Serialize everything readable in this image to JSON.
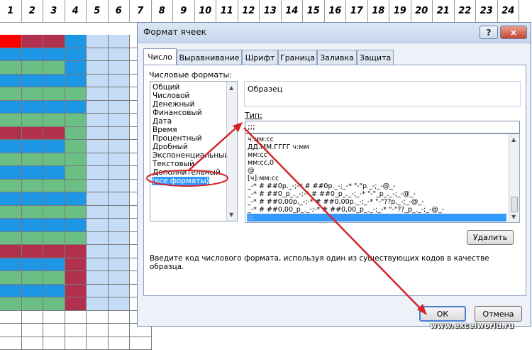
{
  "columns": [
    "1",
    "2",
    "3",
    "4",
    "5",
    "6",
    "7",
    "8",
    "9",
    "10",
    "11",
    "12",
    "13",
    "14",
    "15",
    "16",
    "17",
    "18",
    "19",
    "20",
    "21",
    "22",
    "23",
    "24"
  ],
  "dialog": {
    "title": "Формат ячеек",
    "help_label": "?",
    "close_label": "×",
    "tabs": [
      "Число",
      "Выравнивание",
      "Шрифт",
      "Граница",
      "Заливка",
      "Защита"
    ],
    "formats_label": "Числовые форматы:",
    "formats": [
      "Общий",
      "Числовой",
      "Денежный",
      "Финансовый",
      "Дата",
      "Время",
      "Процентный",
      "Дробный",
      "Экспоненциальный",
      "Текстовый",
      "Дополнительный",
      "(все форматы)"
    ],
    "selected_format": "(все форматы)",
    "sample_label": "Образец",
    "type_label": "Тип:",
    "type_value": ";;;",
    "type_list": [
      "ч:мм:сс",
      "ДД.ММ.ГГГГ ч:мм",
      "мм:сс",
      "мм:сс,0",
      "@",
      "[ч]:мм:сс",
      "_-* # ##0р._-;-* # ##0р._-;_-* \"-\"р._-;_-@_-",
      "_-* # ##0_р_._-;-* # ##0_р_._-;_-* \"-\"_р_._-;_-@_-",
      "_-* # ##0,00р._-;-* # ##0,00р._-;_-* \"-\"??р._-;_-@_-",
      "_-* # ##0,00_р_._-;-* # ##0,00_р_._-;_-* \"-\"??_р_._-;_-@_-",
      ";;;"
    ],
    "selected_type": ";;;",
    "delete_label": "Удалить",
    "hint": "Введите код числового формата, используя один из существующих кодов в качестве образца.",
    "ok_label": "ОК",
    "cancel_label": "Отмена"
  },
  "watermark": "www.excelworld.ru",
  "colors": {
    "red": "#ff0000",
    "maroon": "#b0304e",
    "green": "#6cbf84",
    "blue": "#1e96e6",
    "light_blue": "#c5dcf7",
    "annotation": "#d4242b"
  }
}
